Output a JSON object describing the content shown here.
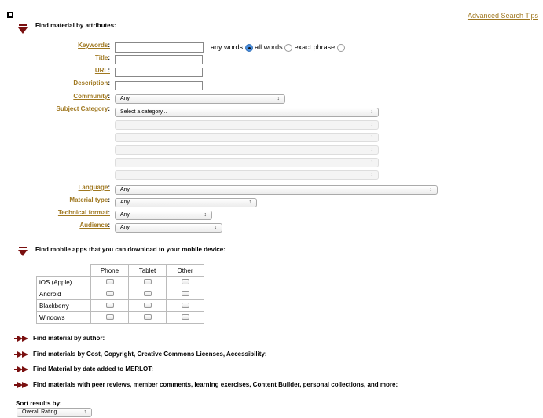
{
  "header": {
    "advanced_link": "Advanced Search Tips"
  },
  "attributes": {
    "title": "Find material by attributes:",
    "keywords_label": "Keywords",
    "title_label": "Title",
    "url_label": "URL",
    "description_label": "Description",
    "community_label": "Community",
    "subject_label": "Subject Category",
    "language_label": "Language",
    "material_type_label": "Material type",
    "technical_format_label": "Technical format",
    "audience_label": "Audience",
    "colon": ":",
    "radio_any": "any words",
    "radio_all": "all words",
    "radio_exact": "exact phrase",
    "community_value": "Any",
    "subject_value": "Select a category...",
    "language_value": "Any",
    "material_type_value": "Any",
    "technical_format_value": "Any",
    "audience_value": "Any"
  },
  "mobile": {
    "title": "Find mobile apps that you can download to your mobile device:",
    "columns": [
      "Phone",
      "Tablet",
      "Other"
    ],
    "rows": [
      "iOS (Apple)",
      "Android",
      "Blackberry",
      "Windows"
    ]
  },
  "collapsed": [
    "Find material by author:",
    "Find materials by Cost, Copyright, Creative Commons Licenses, Accessibility:",
    "Find Material by date added to MERLOT:",
    "Find materials with peer reviews, member comments, learning exercises, Content Builder, personal collections, and more:"
  ],
  "sort": {
    "label": "Sort results by:",
    "value": "Overall Rating"
  },
  "colors": {
    "link": "#a07820",
    "arrow": "#7a1010"
  },
  "icons": {
    "expanded": "triangle-down-icon",
    "collapsed": "red-arrow-right-icon",
    "select": "select-arrows-icon"
  }
}
